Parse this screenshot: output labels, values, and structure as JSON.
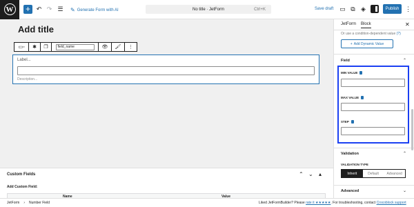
{
  "topbar": {
    "generate_label": "Generate Form with AI",
    "doc_title": "No title · JetForm",
    "shortcut": "Ctrl+K",
    "save_draft": "Save draft",
    "publish": "Publish"
  },
  "canvas": {
    "post_title": "Add title",
    "field_name": "field_name",
    "field_label": "Label...",
    "field_description": "Description..."
  },
  "custom_fields": {
    "title": "Custom Fields",
    "add_label": "Add Custom Field:",
    "columns": [
      "Name",
      "Value"
    ]
  },
  "footer": {
    "breadcrumb": [
      "JetForm",
      "Number Field"
    ],
    "liked_prefix": "Liked JetFormBuilder? Please",
    "rate_link": "rate it ★★★★★",
    "liked_suffix": ". For troubleshooting, contact",
    "support_link": "Crocoblock support"
  },
  "sidebar": {
    "tabs": [
      "JetForm",
      "Block"
    ],
    "active_tab": "Block",
    "condition_text": "Or use a condition-dependent value",
    "condition_link": "(?)",
    "dynamic_button": "Add Dynamic Value",
    "field_section": "Field",
    "min_label": "MIN VALUE",
    "max_label": "MAX VALUE",
    "step_label": "STEP",
    "validation_section": "Validation",
    "validation_type_label": "VALIDATION TYPE",
    "validation_options": [
      "Inherit",
      "Default",
      "Advanced"
    ],
    "validation_selected": "Inherit",
    "advanced_section": "Advanced"
  },
  "colors": {
    "accent": "#2271b1",
    "highlight_border": "#1a3ff2",
    "dark": "#1e1e1e"
  }
}
